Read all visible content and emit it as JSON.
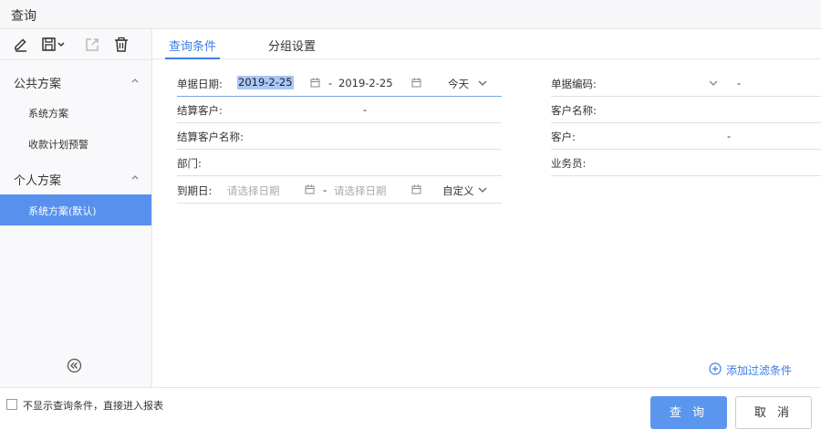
{
  "window": {
    "title": "查询"
  },
  "toolbar": {
    "icons": [
      "edit-icon",
      "save-icon",
      "export-icon",
      "delete-icon"
    ]
  },
  "sidebar": {
    "public_group": {
      "label": "公共方案",
      "items": [
        "系统方案",
        "收款计划预警"
      ]
    },
    "personal_group": {
      "label": "个人方案",
      "items": [
        "系统方案(默认)"
      ]
    },
    "active_item": "系统方案(默认)"
  },
  "tabs": [
    {
      "label": "查询条件",
      "active": true
    },
    {
      "label": "分组设置",
      "active": false
    }
  ],
  "form": {
    "doc_date": {
      "label": "单据日期:",
      "from": "2019-2-25",
      "separator": "-",
      "to": "2019-2-25",
      "range": "今天"
    },
    "settle_customer": {
      "label": "结算客户:",
      "separator": "-"
    },
    "settle_customer_name": {
      "label": "结算客户名称:"
    },
    "department": {
      "label": "部门:"
    },
    "due_date": {
      "label": "到期日:",
      "from_placeholder": "请选择日期",
      "separator": "-",
      "to_placeholder": "请选择日期",
      "range": "自定义"
    },
    "doc_code": {
      "label": "单据编码:",
      "separator": "-"
    },
    "customer_name": {
      "label": "客户名称:"
    },
    "customer": {
      "label": "客户:",
      "separator": "-"
    },
    "salesperson": {
      "label": "业务员:"
    }
  },
  "add_filter": {
    "label": "添加过滤条件"
  },
  "footer": {
    "skip_checkbox_label": "不显示查询条件，直接进入报表",
    "skip_checked": false,
    "query_button": "查 询",
    "cancel_button": "取 消"
  },
  "colors": {
    "accent": "#3d7ce8",
    "active_item_bg": "#5890ee",
    "primary_button": "#5b96ee"
  }
}
